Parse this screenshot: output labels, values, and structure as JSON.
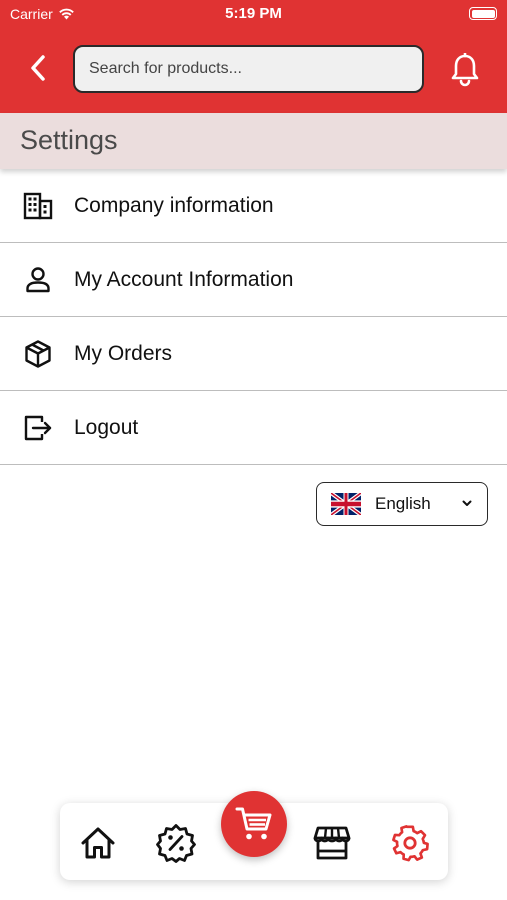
{
  "status_bar": {
    "carrier": "Carrier",
    "time": "5:19 PM"
  },
  "header": {
    "back_icon": "chevron-left-icon",
    "search_placeholder": "Search for products...",
    "notification_icon": "bell-icon",
    "background_color": "#e03333"
  },
  "page": {
    "title": "Settings"
  },
  "menu": {
    "items": [
      {
        "label": "Company information",
        "icon": "building-icon"
      },
      {
        "label": "My Account Information",
        "icon": "user-icon"
      },
      {
        "label": "My Orders",
        "icon": "package-icon"
      },
      {
        "label": "Logout",
        "icon": "logout-icon"
      }
    ]
  },
  "language": {
    "selected": "English",
    "flag_icon": "uk-flag-icon"
  },
  "bottom_nav": {
    "items": [
      {
        "icon": "home-icon",
        "active": false
      },
      {
        "icon": "discount-badge-icon",
        "active": false
      },
      {
        "icon": "cart-icon",
        "active": false
      },
      {
        "icon": "store-icon",
        "active": false
      },
      {
        "icon": "gear-icon",
        "active": true
      }
    ],
    "active_color": "#e03333"
  }
}
